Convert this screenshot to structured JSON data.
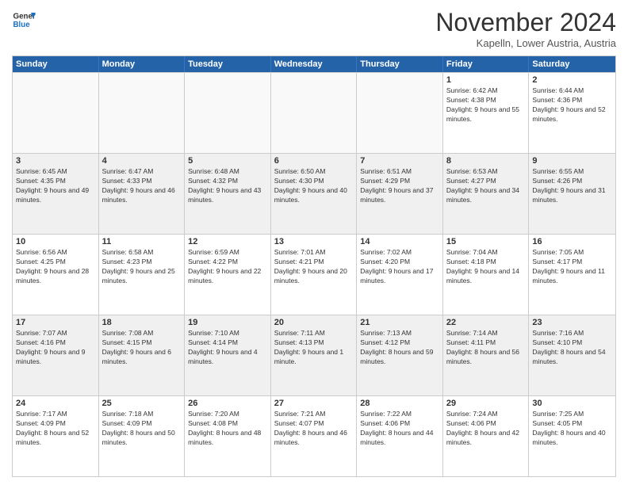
{
  "logo": {
    "line1": "General",
    "line2": "Blue"
  },
  "title": "November 2024",
  "subtitle": "Kapelln, Lower Austria, Austria",
  "headers": [
    "Sunday",
    "Monday",
    "Tuesday",
    "Wednesday",
    "Thursday",
    "Friday",
    "Saturday"
  ],
  "rows": [
    [
      {
        "day": "",
        "info": ""
      },
      {
        "day": "",
        "info": ""
      },
      {
        "day": "",
        "info": ""
      },
      {
        "day": "",
        "info": ""
      },
      {
        "day": "",
        "info": ""
      },
      {
        "day": "1",
        "info": "Sunrise: 6:42 AM\nSunset: 4:38 PM\nDaylight: 9 hours and 55 minutes."
      },
      {
        "day": "2",
        "info": "Sunrise: 6:44 AM\nSunset: 4:36 PM\nDaylight: 9 hours and 52 minutes."
      }
    ],
    [
      {
        "day": "3",
        "info": "Sunrise: 6:45 AM\nSunset: 4:35 PM\nDaylight: 9 hours and 49 minutes."
      },
      {
        "day": "4",
        "info": "Sunrise: 6:47 AM\nSunset: 4:33 PM\nDaylight: 9 hours and 46 minutes."
      },
      {
        "day": "5",
        "info": "Sunrise: 6:48 AM\nSunset: 4:32 PM\nDaylight: 9 hours and 43 minutes."
      },
      {
        "day": "6",
        "info": "Sunrise: 6:50 AM\nSunset: 4:30 PM\nDaylight: 9 hours and 40 minutes."
      },
      {
        "day": "7",
        "info": "Sunrise: 6:51 AM\nSunset: 4:29 PM\nDaylight: 9 hours and 37 minutes."
      },
      {
        "day": "8",
        "info": "Sunrise: 6:53 AM\nSunset: 4:27 PM\nDaylight: 9 hours and 34 minutes."
      },
      {
        "day": "9",
        "info": "Sunrise: 6:55 AM\nSunset: 4:26 PM\nDaylight: 9 hours and 31 minutes."
      }
    ],
    [
      {
        "day": "10",
        "info": "Sunrise: 6:56 AM\nSunset: 4:25 PM\nDaylight: 9 hours and 28 minutes."
      },
      {
        "day": "11",
        "info": "Sunrise: 6:58 AM\nSunset: 4:23 PM\nDaylight: 9 hours and 25 minutes."
      },
      {
        "day": "12",
        "info": "Sunrise: 6:59 AM\nSunset: 4:22 PM\nDaylight: 9 hours and 22 minutes."
      },
      {
        "day": "13",
        "info": "Sunrise: 7:01 AM\nSunset: 4:21 PM\nDaylight: 9 hours and 20 minutes."
      },
      {
        "day": "14",
        "info": "Sunrise: 7:02 AM\nSunset: 4:20 PM\nDaylight: 9 hours and 17 minutes."
      },
      {
        "day": "15",
        "info": "Sunrise: 7:04 AM\nSunset: 4:18 PM\nDaylight: 9 hours and 14 minutes."
      },
      {
        "day": "16",
        "info": "Sunrise: 7:05 AM\nSunset: 4:17 PM\nDaylight: 9 hours and 11 minutes."
      }
    ],
    [
      {
        "day": "17",
        "info": "Sunrise: 7:07 AM\nSunset: 4:16 PM\nDaylight: 9 hours and 9 minutes."
      },
      {
        "day": "18",
        "info": "Sunrise: 7:08 AM\nSunset: 4:15 PM\nDaylight: 9 hours and 6 minutes."
      },
      {
        "day": "19",
        "info": "Sunrise: 7:10 AM\nSunset: 4:14 PM\nDaylight: 9 hours and 4 minutes."
      },
      {
        "day": "20",
        "info": "Sunrise: 7:11 AM\nSunset: 4:13 PM\nDaylight: 9 hours and 1 minute."
      },
      {
        "day": "21",
        "info": "Sunrise: 7:13 AM\nSunset: 4:12 PM\nDaylight: 8 hours and 59 minutes."
      },
      {
        "day": "22",
        "info": "Sunrise: 7:14 AM\nSunset: 4:11 PM\nDaylight: 8 hours and 56 minutes."
      },
      {
        "day": "23",
        "info": "Sunrise: 7:16 AM\nSunset: 4:10 PM\nDaylight: 8 hours and 54 minutes."
      }
    ],
    [
      {
        "day": "24",
        "info": "Sunrise: 7:17 AM\nSunset: 4:09 PM\nDaylight: 8 hours and 52 minutes."
      },
      {
        "day": "25",
        "info": "Sunrise: 7:18 AM\nSunset: 4:09 PM\nDaylight: 8 hours and 50 minutes."
      },
      {
        "day": "26",
        "info": "Sunrise: 7:20 AM\nSunset: 4:08 PM\nDaylight: 8 hours and 48 minutes."
      },
      {
        "day": "27",
        "info": "Sunrise: 7:21 AM\nSunset: 4:07 PM\nDaylight: 8 hours and 46 minutes."
      },
      {
        "day": "28",
        "info": "Sunrise: 7:22 AM\nSunset: 4:06 PM\nDaylight: 8 hours and 44 minutes."
      },
      {
        "day": "29",
        "info": "Sunrise: 7:24 AM\nSunset: 4:06 PM\nDaylight: 8 hours and 42 minutes."
      },
      {
        "day": "30",
        "info": "Sunrise: 7:25 AM\nSunset: 4:05 PM\nDaylight: 8 hours and 40 minutes."
      }
    ]
  ]
}
